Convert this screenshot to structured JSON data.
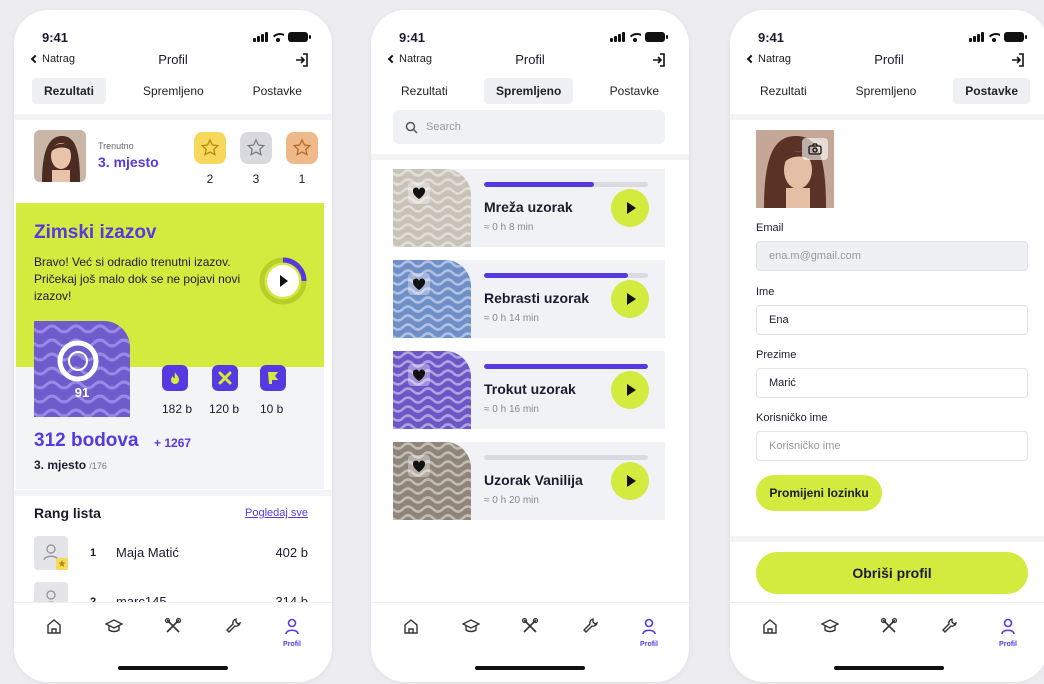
{
  "status": {
    "time": "9:41"
  },
  "nav": {
    "back": "Natrag",
    "title": "Profil"
  },
  "tabs": [
    "Rezultati",
    "Spremljeno",
    "Postavke"
  ],
  "bottom_nav": {
    "active_label": "Profil"
  },
  "screen1": {
    "current_label": "Trenutno",
    "place": "3. mjesto",
    "badges": [
      {
        "color": "#f6d95a",
        "count": "2"
      },
      {
        "color": "#d9dadf",
        "count": "3"
      },
      {
        "color": "#f0b98a",
        "count": "1"
      }
    ],
    "challenge": {
      "title": "Zimski izazov",
      "text": "Bravo! Već si odradio trenutni izazov. Pričekaj još malo dok se ne pojavi novi izazov!",
      "score": "91",
      "stats": [
        "182 b",
        "120 b",
        "10 b"
      ]
    },
    "points": "312 bodova",
    "points_delta": "+ 1267",
    "rank": "3. mjesto",
    "rank_of": "/176",
    "leaderboard": {
      "title": "Rang lista",
      "link": "Pogledaj sve",
      "rows": [
        {
          "rank": "1",
          "name": "Maja Matić",
          "score": "402 b"
        },
        {
          "rank": "2",
          "name": "marc145",
          "score": "314 b"
        }
      ]
    }
  },
  "screen2": {
    "search_placeholder": "Search",
    "items": [
      {
        "title": "Mreža uzorak",
        "duration": "≈ 0 h 8 min",
        "progress": 0.67,
        "swatch": "#c9c2b8"
      },
      {
        "title": "Rebrasti uzorak",
        "duration": "≈ 0 h 14 min",
        "progress": 0.88,
        "swatch": "#6f8fc8"
      },
      {
        "title": "Trokut uzorak",
        "duration": "≈ 0 h 16 min",
        "progress": 1.0,
        "swatch": "#6d57c6"
      },
      {
        "title": "Uzorak Vanilija",
        "duration": "≈ 0 h 20 min",
        "progress": 0.0,
        "swatch": "#8f8579"
      }
    ]
  },
  "screen3": {
    "email_label": "Email",
    "email_value": "ena.m@gmail.com",
    "name_label": "Ime",
    "name_value": "Ena",
    "surname_label": "Prezime",
    "surname_value": "Marić",
    "username_label": "Korisničko ime",
    "username_placeholder": "Korisničko ime",
    "change_password": "Promijeni lozinku",
    "delete_profile": "Obriši profil"
  },
  "colors": {
    "accent": "#5639e0",
    "lime": "#d3ea3e"
  }
}
